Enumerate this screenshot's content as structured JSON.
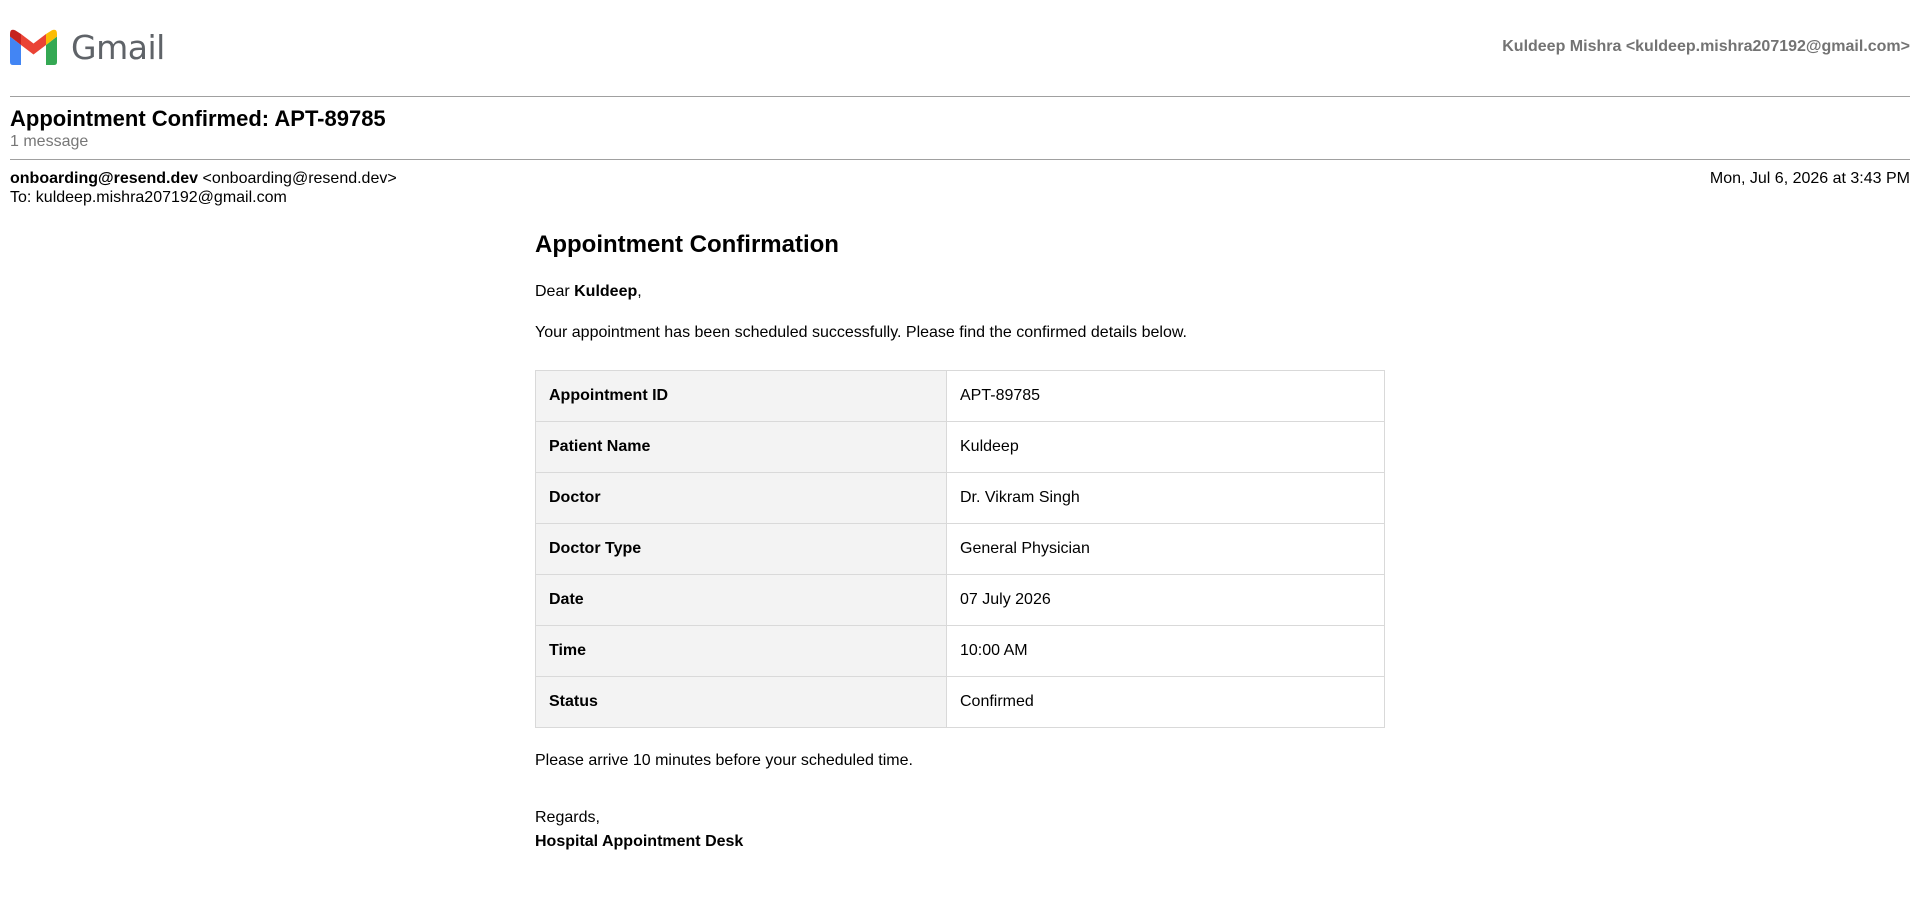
{
  "header": {
    "logo_text": "Gmail",
    "account": "Kuldeep Mishra <kuldeep.mishra207192@gmail.com>"
  },
  "thread": {
    "subject": "Appointment Confirmed: APT-89785",
    "message_count": "1 message"
  },
  "message": {
    "from_name": "onboarding@resend.dev",
    "from_email": "<onboarding@resend.dev>",
    "to": "To: kuldeep.mishra207192@gmail.com",
    "date": "Mon, Jul 6, 2026 at 3:43 PM"
  },
  "email_body": {
    "heading": "Appointment Confirmation",
    "greeting_prefix": "Dear ",
    "patient_first_name": "Kuldeep",
    "greeting_suffix": ",",
    "intro": "Your appointment has been scheduled successfully. Please find the confirmed details below.",
    "details": [
      {
        "label": "Appointment ID",
        "value": "APT-89785"
      },
      {
        "label": "Patient Name",
        "value": "Kuldeep"
      },
      {
        "label": "Doctor",
        "value": "Dr. Vikram Singh"
      },
      {
        "label": "Doctor Type",
        "value": "General Physician"
      },
      {
        "label": "Date",
        "value": "07 July 2026"
      },
      {
        "label": "Time",
        "value": "10:00 AM"
      },
      {
        "label": "Status",
        "value": "Confirmed"
      }
    ],
    "arrival_note": "Please arrive 10 minutes before your scheduled time.",
    "regards": "Regards,",
    "signature": "Hospital Appointment Desk"
  },
  "colors": {
    "gmail_red": "#EA4335",
    "gmail_blue": "#4285F4",
    "gmail_green": "#34A853",
    "gmail_yellow": "#FBBC04",
    "gmail_dark_red": "#C5221F",
    "label_bg": "#f3f3f3",
    "border": "#d9d9d9"
  },
  "icons": {
    "logo": "gmail-logo-icon"
  }
}
